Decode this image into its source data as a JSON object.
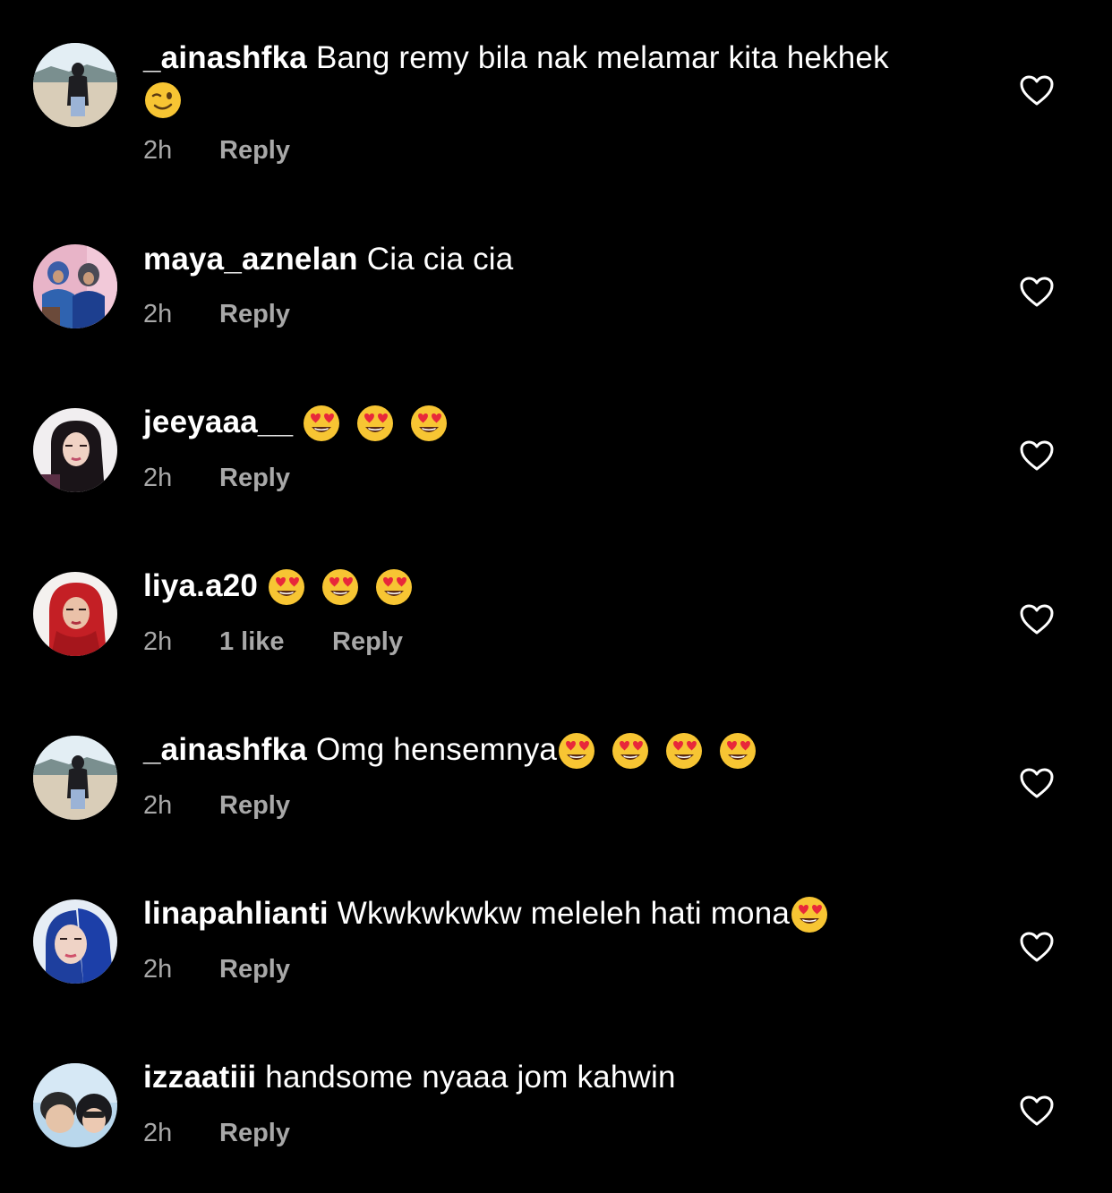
{
  "comments": [
    {
      "username": "_ainashfka",
      "text": "Bang remy bila nak melamar kita hekhek",
      "emojis": [
        "winking-face"
      ],
      "time": "2h",
      "likes": "",
      "reply_label": "Reply",
      "avatar": "beach-portrait"
    },
    {
      "username": "maya_aznelan",
      "text": "Cia cia cia",
      "emojis": [],
      "time": "2h",
      "likes": "",
      "reply_label": "Reply",
      "avatar": "two-people-portrait"
    },
    {
      "username": "jeeyaaa__",
      "text": "",
      "emojis": [
        "heart-eyes",
        "heart-eyes",
        "heart-eyes"
      ],
      "time": "2h",
      "likes": "",
      "reply_label": "Reply",
      "avatar": "hijab-portrait"
    },
    {
      "username": "liya.a20",
      "text": "",
      "emojis": [
        "heart-eyes",
        "heart-eyes",
        "heart-eyes"
      ],
      "time": "2h",
      "likes": "1 like",
      "reply_label": "Reply",
      "avatar": "red-hijab-portrait"
    },
    {
      "username": "_ainashfka",
      "text": "Omg hensemnya",
      "emojis": [
        "heart-eyes",
        "heart-eyes",
        "heart-eyes",
        "heart-eyes"
      ],
      "time": "2h",
      "likes": "",
      "reply_label": "Reply",
      "avatar": "beach-portrait"
    },
    {
      "username": "linapahlianti",
      "text": "Wkwkwkwkw meleleh hati mona",
      "emojis": [
        "heart-eyes"
      ],
      "time": "2h",
      "likes": "",
      "reply_label": "Reply",
      "avatar": "blue-hijab-portrait"
    },
    {
      "username": "izzaatiii",
      "text": "handsome nyaaa jom kahwin",
      "emojis": [],
      "time": "2h",
      "likes": "",
      "reply_label": "Reply",
      "avatar": "couple-selfie"
    }
  ],
  "colors": {
    "background": "#000000",
    "text": "#ffffff",
    "meta": "#a8a8a8",
    "heart_outline": "#ffffff"
  },
  "icons": {
    "like": "heart-outline-icon"
  }
}
